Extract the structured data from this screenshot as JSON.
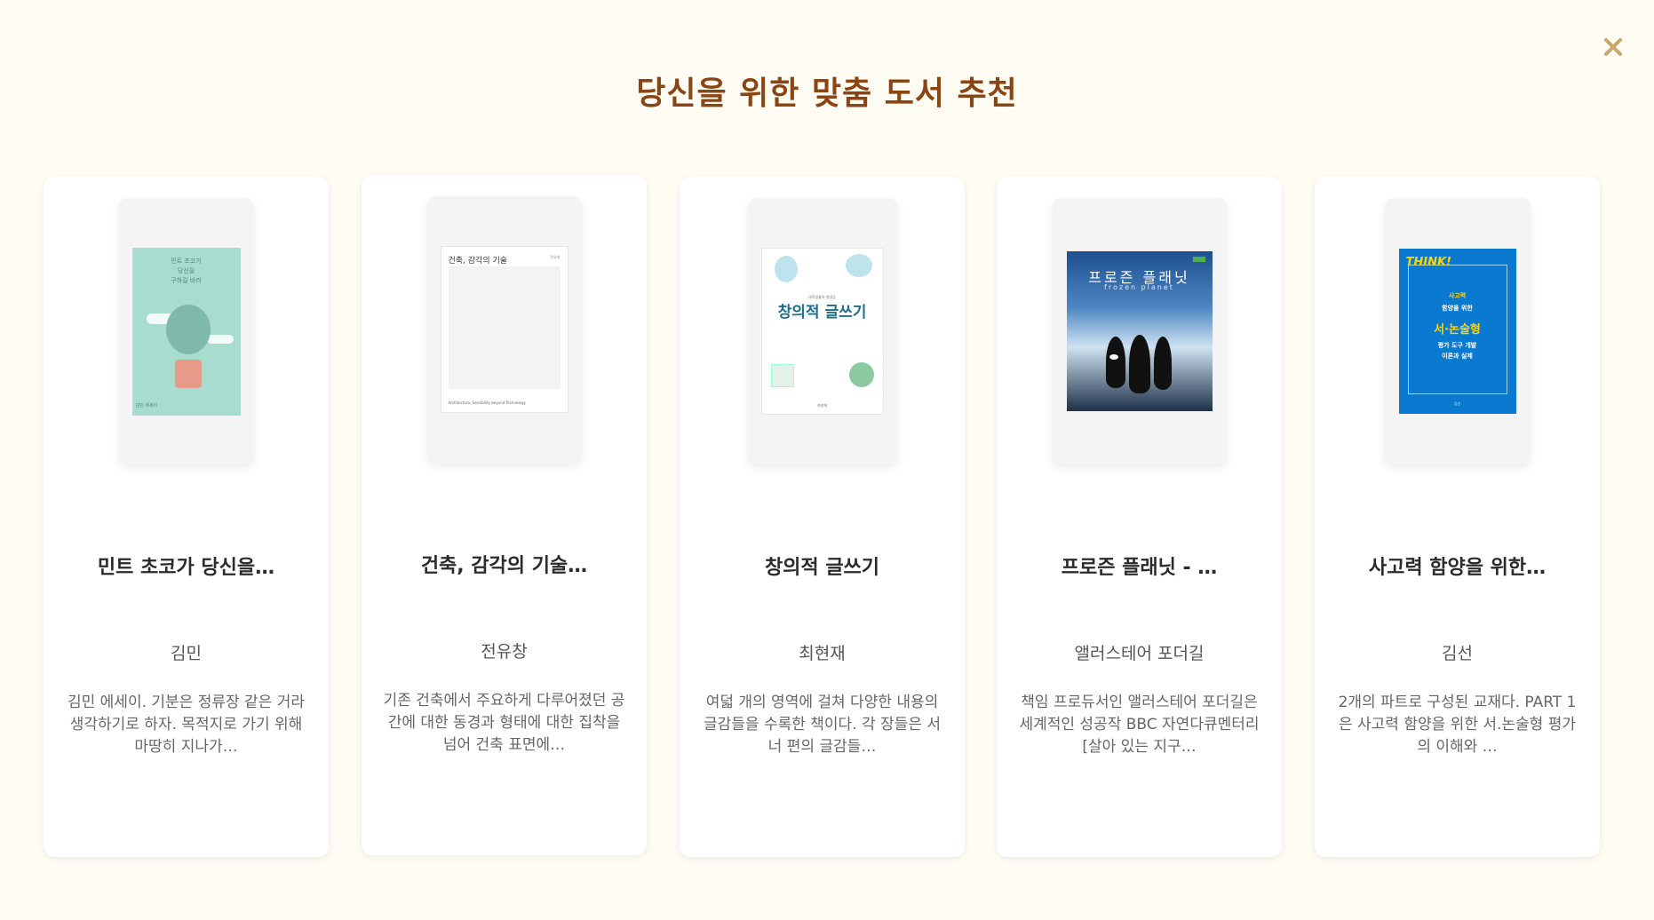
{
  "header": {
    "title": "당신을 위한 맞춤 도서 추천",
    "close_icon": "close-icon",
    "close_glyph": "✕"
  },
  "colors": {
    "background": "#fffcf4",
    "title": "#8b4513",
    "close": "#c9a76a"
  },
  "books": [
    {
      "title": "민트 초코가 당신을…",
      "author": "김민",
      "description": "김민 에세이. 기분은 정류장 같은 거라 생각하기로 하자. 목적지로 가기 위해 마땅히 지나가…",
      "cover": {
        "lines": [
          "민트 초코가",
          "당신을",
          "구하길 바라"
        ],
        "bottom": "김민 에세이"
      }
    },
    {
      "title": "건축, 감각의 기술…",
      "author": "전유창",
      "description": "기존 건축에서 주요하게 다루어졌던 공간에 대한 동경과 형태에 대한 집착을 넘어 건축 표면에…",
      "cover": {
        "title": "건축, 감각의 기술",
        "subtitle": "전유창",
        "bottom": "Architecture, Sensibility beyond Technology"
      }
    },
    {
      "title": "창의적 글쓰기",
      "author": "최현재",
      "description": "여덟 개의 영역에 걸쳐 다양한 내용의 글감들을 수록한 책이다. 각 장들은 서너 편의 글감들…",
      "cover": {
        "title": "창의적 글쓰기",
        "subtitle": "대학생활의 첫걸음",
        "bottom": "최현재"
      }
    },
    {
      "title": "프로즌 플래닛 - …",
      "author": "앨러스테어 포더길",
      "description": "책임 프로듀서인 앨러스테어 포더길은 세계적인 성공작 BBC 자연다큐멘터리 [살아 있는 지구…",
      "cover": {
        "title": "프로즌 플래닛",
        "subtitle": "frozen planet"
      }
    },
    {
      "title": "사고력 함양을 위한…",
      "author": "김선",
      "description": "2개의 파트로 구성된 교재다. PART 1은 사고력 함양을 위한 서.논술형 평가의 이해와 …",
      "cover": {
        "think": "THINK!",
        "line1": "사고력",
        "line2": "함양을 위한",
        "line3": "서·논술형",
        "line4": "평가 도구 개발",
        "line5": "이론과 실제",
        "bottom": "김선"
      }
    }
  ]
}
